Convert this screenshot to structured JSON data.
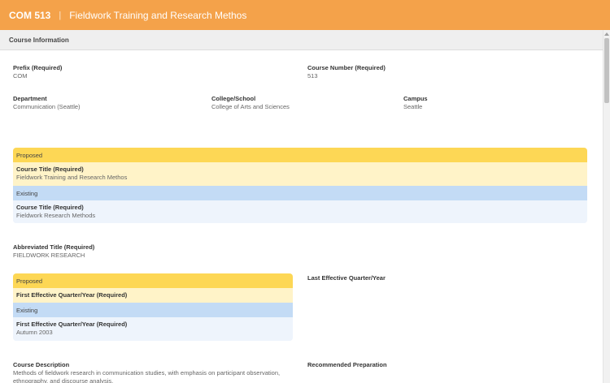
{
  "header": {
    "course_code": "COM 513",
    "separator": "|",
    "course_title": "Fieldwork Training and Research Methos"
  },
  "section": {
    "title": "Course Information"
  },
  "fields": {
    "prefix": {
      "label": "Prefix (Required)",
      "value": "COM"
    },
    "course_number": {
      "label": "Course Number (Required)",
      "value": "513"
    },
    "department": {
      "label": "Department",
      "value": "Communication (Seattle)"
    },
    "college": {
      "label": "College/School",
      "value": "College of Arts and Sciences"
    },
    "campus": {
      "label": "Campus",
      "value": "Seattle"
    },
    "abbreviated_title": {
      "label": "Abbreviated Title (Required)",
      "value": "FIELDWORK RESEARCH"
    },
    "last_effective": {
      "label": "Last Effective Quarter/Year"
    },
    "course_description": {
      "label": "Course Description",
      "value": "Methods of fieldwork research in communication studies, with emphasis on participant observation, ethnography, and discourse analysis."
    },
    "recommended_preparation": {
      "label": "Recommended Preparation"
    }
  },
  "title_compare": {
    "proposed_label": "Proposed",
    "proposed_field_label": "Course Title (Required)",
    "proposed_value": "Fieldwork Training and Research Methos",
    "existing_label": "Existing",
    "existing_field_label": "Course Title (Required)",
    "existing_value": "Fieldwork Research Methods"
  },
  "first_effective_compare": {
    "proposed_label": "Proposed",
    "proposed_field_label": "First Effective Quarter/Year (Required)",
    "existing_label": "Existing",
    "existing_field_label": "First Effective Quarter/Year (Required)",
    "existing_value": "Autumn 2003"
  },
  "colors": {
    "header_bg": "#f4a24a",
    "proposed_head": "#fdd755",
    "proposed_body": "#fff3c8",
    "existing_head": "#c3dbf5",
    "existing_body": "#eef4fc"
  }
}
